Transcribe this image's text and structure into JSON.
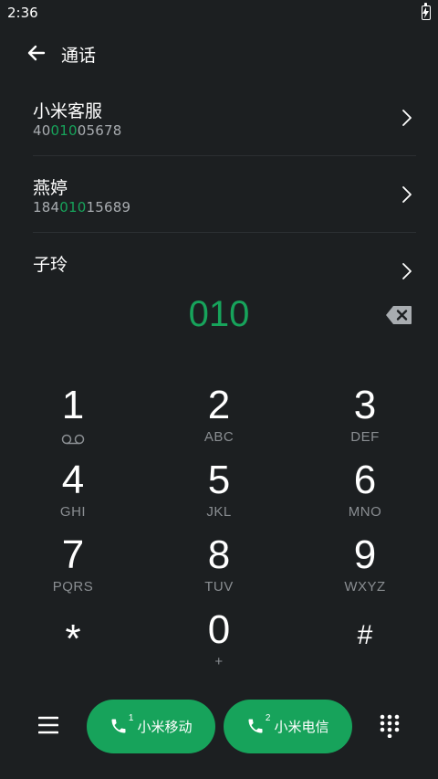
{
  "status_bar": {
    "time": "2:36",
    "battery_icon": "battery-charging-icon"
  },
  "header": {
    "title": "通话",
    "back_icon": "arrow-left-icon"
  },
  "contacts": [
    {
      "name": "小米客服",
      "number_parts": [
        "40",
        "010",
        "05678"
      ]
    },
    {
      "name": "燕婷",
      "number_parts": [
        "184",
        "010",
        "15689"
      ]
    },
    {
      "name": "子玲",
      "number_parts": [
        "",
        "",
        ""
      ]
    }
  ],
  "dial": {
    "input": "010"
  },
  "keypad": [
    {
      "digit": "1",
      "letters": ""
    },
    {
      "digit": "2",
      "letters": "ABC"
    },
    {
      "digit": "3",
      "letters": "DEF"
    },
    {
      "digit": "4",
      "letters": "GHI"
    },
    {
      "digit": "5",
      "letters": "JKL"
    },
    {
      "digit": "6",
      "letters": "MNO"
    },
    {
      "digit": "7",
      "letters": "PQRS"
    },
    {
      "digit": "8",
      "letters": "TUV"
    },
    {
      "digit": "9",
      "letters": "WXYZ"
    },
    {
      "digit": "*",
      "letters": ""
    },
    {
      "digit": "0",
      "letters": "+"
    },
    {
      "digit": "#",
      "letters": ""
    }
  ],
  "bottom_bar": {
    "sim1": {
      "slot": "1",
      "label": "小米移动"
    },
    "sim2": {
      "slot": "2",
      "label": "小米电信"
    }
  },
  "colors": {
    "background": "#1c1f21",
    "accent": "#17a35b",
    "secondary_text": "#8a8e92"
  }
}
